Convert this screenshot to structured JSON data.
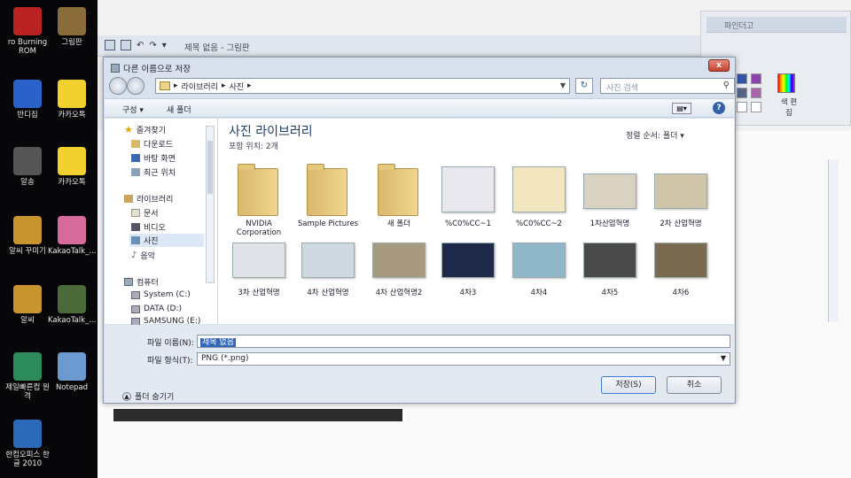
{
  "desktop": {
    "icons": [
      {
        "label": "ro Burning ROM",
        "icon": "nero-icon",
        "color": "#b22"
      },
      {
        "label": "그림판",
        "icon": "paint-icon",
        "color": "#8a6d3b"
      },
      {
        "label": "반디집",
        "icon": "bandizip-icon",
        "color": "#2b62c9"
      },
      {
        "label": "카카오톡",
        "icon": "kakaotalk-icon",
        "color": "#f2d12e"
      },
      {
        "label": "알송",
        "icon": "alsong-icon",
        "color": "#555"
      },
      {
        "label": "카카오톡",
        "icon": "kakaotalk-talk-icon",
        "color": "#f2d12e"
      },
      {
        "label": "알씨 꾸미기",
        "icon": "alsee-deco-icon",
        "color": "#c8942e"
      },
      {
        "label": "KakaoTalk_...",
        "icon": "image-file-icon",
        "color": "#d66a9a"
      },
      {
        "label": "알씨",
        "icon": "alsee-icon",
        "color": "#c8942e"
      },
      {
        "label": "KakaoTalk_...",
        "icon": "image-file-icon",
        "color": "#4a6a3a"
      },
      {
        "label": "제일빠른컴 원격",
        "icon": "remote-icon",
        "color": "#2d8a5a"
      },
      {
        "label": "Notepad",
        "icon": "notepad-icon",
        "color": "#6a9ad0"
      },
      {
        "label": "한컴오피스 한글 2010",
        "icon": "hangul-icon",
        "color": "#2b6ab8"
      }
    ]
  },
  "paint": {
    "title": "제목 없음 - 그림판",
    "ribbon_group": "색 편집",
    "ribbon_header": "파인더고"
  },
  "dialog": {
    "title": "다른 이름으로 저장",
    "close_label": "x",
    "address": [
      "라이브러리",
      "사진"
    ],
    "search_placeholder": "사진 검색",
    "toolbar": {
      "organize": "구성 ▾",
      "new_folder": "새 폴더"
    },
    "nav": {
      "favorites": "즐겨찾기",
      "downloads": "다운로드",
      "desktop": "바탕 화면",
      "recent": "최근 위치",
      "libraries": "라이브러리",
      "documents": "문서",
      "videos": "비디오",
      "pictures": "사진",
      "music": "음악",
      "computer": "컴퓨터",
      "drive_c": "System (C:)",
      "drive_d": "DATA (D:)",
      "drive_e": "SAMSUNG (E:)"
    },
    "library_title": "사진 라이브러리",
    "library_sub": "포함 위치: 2개",
    "sort_label": "정렬 순서:",
    "sort_value": "폴더 ▾",
    "items": [
      {
        "label": "NVIDIA Corporation",
        "kind": "folder"
      },
      {
        "label": "Sample Pictures",
        "kind": "folder"
      },
      {
        "label": "새 폴더",
        "kind": "folder"
      },
      {
        "label": "%C0%CC~1",
        "kind": "image",
        "color": "#e8e8ee"
      },
      {
        "label": "%C0%CC~2",
        "kind": "image",
        "color": "#f1e6c0"
      },
      {
        "label": "1차산업혁명",
        "kind": "image",
        "color": "#d9d2c3"
      },
      {
        "label": "2차 산업혁명",
        "kind": "image",
        "color": "#cfc5a8"
      },
      {
        "label": "3차 산업혁명",
        "kind": "image",
        "color": "#dfe3e8"
      },
      {
        "label": "4차 산업혁명",
        "kind": "image",
        "color": "#cfd7df"
      },
      {
        "label": "4차 산업혁명2",
        "kind": "image",
        "color": "#a89a80"
      },
      {
        "label": "4차3",
        "kind": "image",
        "color": "#1f2a4a"
      },
      {
        "label": "4차4",
        "kind": "image",
        "color": "#8fb6c9"
      },
      {
        "label": "4차5",
        "kind": "image",
        "color": "#4a4a4a"
      },
      {
        "label": "4차6",
        "kind": "image",
        "color": "#7a6a50"
      }
    ],
    "file_name_label": "파일 이름(N):",
    "file_name_value": "제목 없음",
    "file_type_label": "파일 형식(T):",
    "file_type_value": "PNG (*.png)",
    "hide_folders": "폴더 숨기기",
    "save_label": "저장(S)",
    "cancel_label": "취소"
  }
}
